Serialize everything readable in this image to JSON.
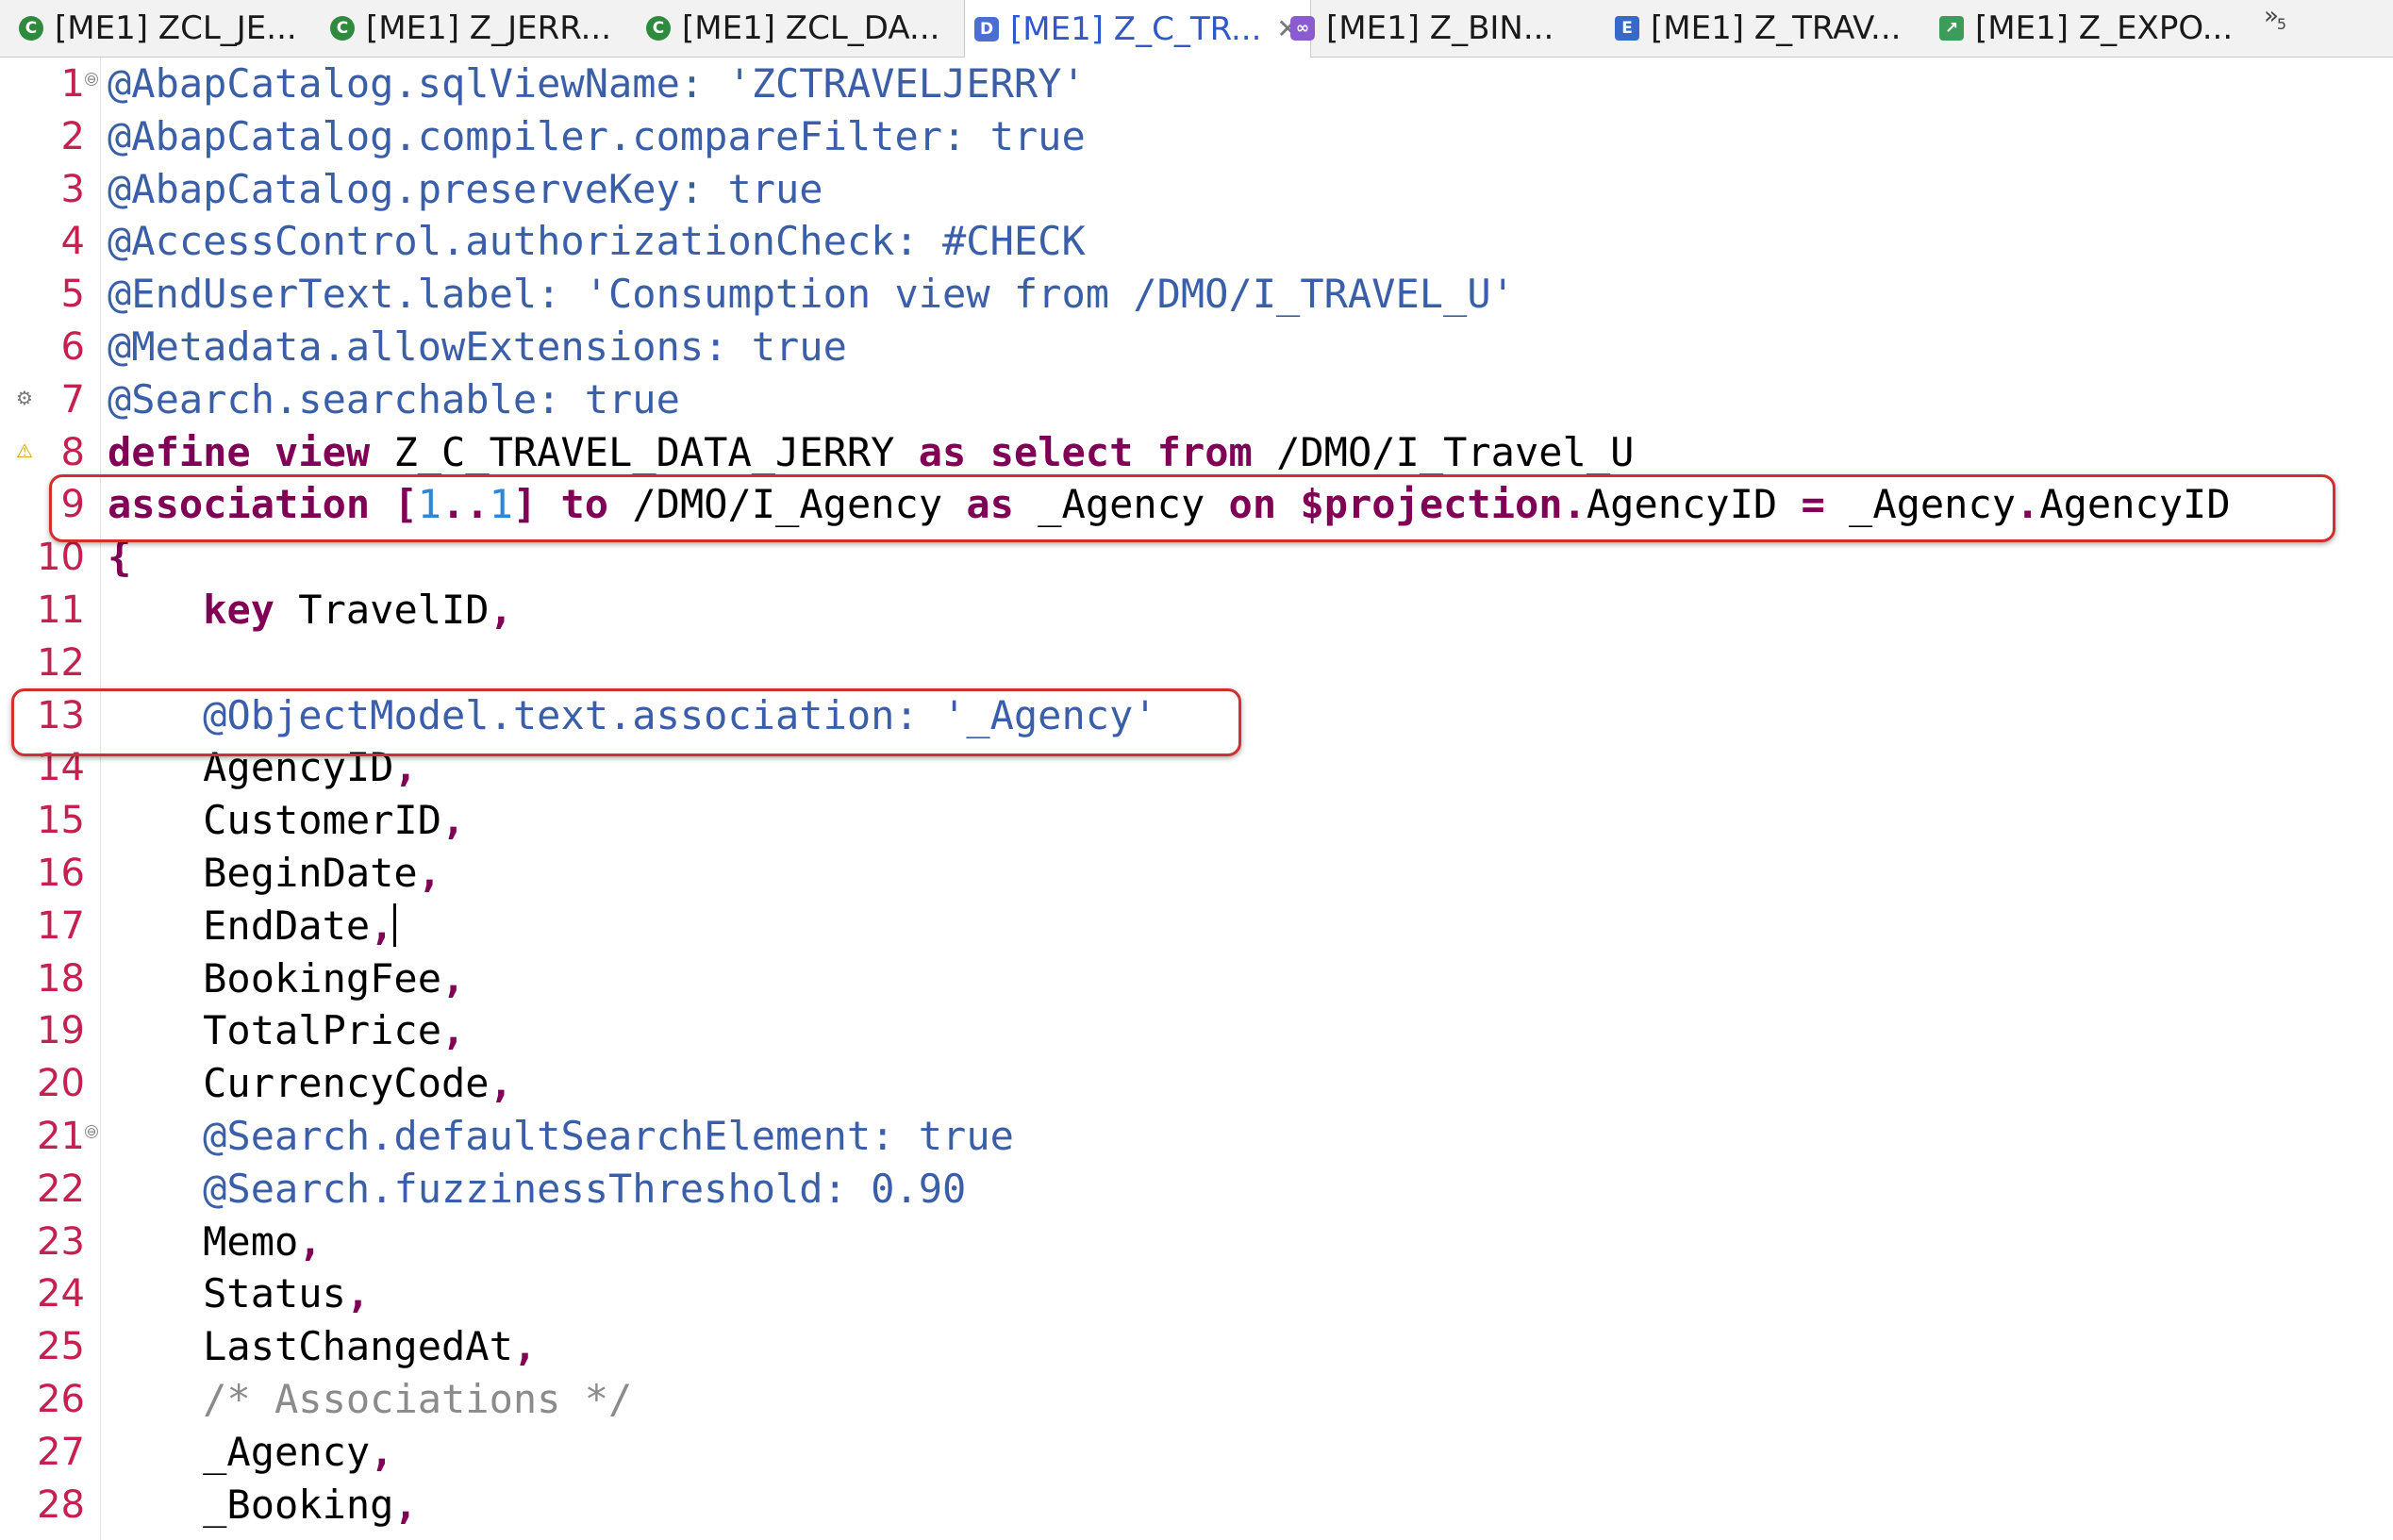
{
  "tabs": [
    {
      "label": "[ME1] ZCL_JE...",
      "icon": "class-icon"
    },
    {
      "label": "[ME1] Z_JERR...",
      "icon": "class-icon"
    },
    {
      "label": "[ME1] ZCL_DA...",
      "icon": "class-icon"
    },
    {
      "label": "[ME1] Z_C_TR...",
      "icon": "ddl-source-icon",
      "active": true,
      "close": "✕"
    },
    {
      "label": "[ME1] Z_BIN...",
      "icon": "service-binding-icon"
    },
    {
      "label": "[ME1] Z_TRAV...",
      "icon": "entity-icon"
    },
    {
      "label": "[ME1] Z_EXPO...",
      "icon": "export-icon"
    }
  ],
  "tab_overflow": {
    "symbol": "»",
    "count": "5"
  },
  "editor": {
    "lines": [
      {
        "n": "1",
        "fold": "⊖",
        "segs": [
          [
            "ann",
            "@AbapCatalog.sqlViewName: "
          ],
          [
            "str2",
            "'ZCTRAVELJERRY'"
          ]
        ]
      },
      {
        "n": "2",
        "segs": [
          [
            "ann",
            "@AbapCatalog.compiler.compareFilter: "
          ],
          [
            "val",
            "true"
          ]
        ]
      },
      {
        "n": "3",
        "segs": [
          [
            "ann",
            "@AbapCatalog.preserveKey: "
          ],
          [
            "val",
            "true"
          ]
        ]
      },
      {
        "n": "4",
        "segs": [
          [
            "ann",
            "@AccessControl.authorizationCheck: "
          ],
          [
            "val",
            "#CHECK"
          ]
        ]
      },
      {
        "n": "5",
        "segs": [
          [
            "ann",
            "@EndUserText.label: "
          ],
          [
            "str2",
            "'Consumption view from /DMO/I_TRAVEL_U'"
          ]
        ]
      },
      {
        "n": "6",
        "segs": [
          [
            "ann",
            "@Metadata.allowExtensions: "
          ],
          [
            "val",
            "true"
          ]
        ]
      },
      {
        "n": "7",
        "marker": "gear",
        "segs": [
          [
            "ann",
            "@Search.searchable: "
          ],
          [
            "val",
            "true"
          ]
        ]
      },
      {
        "n": "8",
        "marker": "warn",
        "segs": [
          [
            "kw",
            "define"
          ],
          [
            "",
            " "
          ],
          [
            "kw",
            "view"
          ],
          [
            "",
            " Z_C_TRAVEL_DATA_JERRY "
          ],
          [
            "kw",
            "as"
          ],
          [
            "",
            " "
          ],
          [
            "kw",
            "select"
          ],
          [
            "",
            " "
          ],
          [
            "kw",
            "from"
          ],
          [
            "",
            " /DMO/I_Travel_U"
          ]
        ]
      },
      {
        "n": "9",
        "segs": [
          [
            "kw",
            "association"
          ],
          [
            "",
            " "
          ],
          [
            "punc",
            "["
          ],
          [
            "num",
            "1"
          ],
          [
            "punc",
            ".."
          ],
          [
            "num",
            "1"
          ],
          [
            "punc",
            "]"
          ],
          [
            "",
            " "
          ],
          [
            "kw",
            "to"
          ],
          [
            "",
            " /DMO/I_Agency "
          ],
          [
            "kw",
            "as"
          ],
          [
            "",
            " _Agency "
          ],
          [
            "kw",
            "on"
          ],
          [
            "",
            " "
          ],
          [
            "kw",
            "$projection"
          ],
          [
            "punc",
            "."
          ],
          [
            "",
            "AgencyID "
          ],
          [
            "punc",
            "="
          ],
          [
            "",
            " _Agency"
          ],
          [
            "punc",
            "."
          ],
          [
            "",
            "AgencyID"
          ]
        ]
      },
      {
        "n": "10",
        "segs": [
          [
            "punc",
            "{"
          ]
        ]
      },
      {
        "n": "11",
        "segs": [
          [
            "",
            "    "
          ],
          [
            "kw",
            "key"
          ],
          [
            "",
            " TravelID"
          ],
          [
            "punc",
            ","
          ]
        ]
      },
      {
        "n": "12",
        "segs": []
      },
      {
        "n": "13",
        "segs": [
          [
            "",
            "    "
          ],
          [
            "ann",
            "@ObjectModel.text.association: "
          ],
          [
            "str2",
            "'_Agency'"
          ]
        ]
      },
      {
        "n": "14",
        "segs": [
          [
            "",
            "    AgencyID"
          ],
          [
            "punc",
            ","
          ]
        ]
      },
      {
        "n": "15",
        "segs": [
          [
            "",
            "    CustomerID"
          ],
          [
            "punc",
            ","
          ]
        ]
      },
      {
        "n": "16",
        "segs": [
          [
            "",
            "    BeginDate"
          ],
          [
            "punc",
            ","
          ]
        ]
      },
      {
        "n": "17",
        "caret": true,
        "segs": [
          [
            "",
            "    EndDate"
          ],
          [
            "punc",
            ","
          ]
        ]
      },
      {
        "n": "18",
        "segs": [
          [
            "",
            "    BookingFee"
          ],
          [
            "punc",
            ","
          ]
        ]
      },
      {
        "n": "19",
        "segs": [
          [
            "",
            "    TotalPrice"
          ],
          [
            "punc",
            ","
          ]
        ]
      },
      {
        "n": "20",
        "segs": [
          [
            "",
            "    CurrencyCode"
          ],
          [
            "punc",
            ","
          ]
        ]
      },
      {
        "n": "21",
        "fold": "⊖",
        "segs": [
          [
            "",
            "    "
          ],
          [
            "ann",
            "@Search.defaultSearchElement: "
          ],
          [
            "val",
            "true"
          ]
        ]
      },
      {
        "n": "22",
        "segs": [
          [
            "",
            "    "
          ],
          [
            "ann",
            "@Search.fuzzinessThreshold: "
          ],
          [
            "val",
            "0.90"
          ]
        ]
      },
      {
        "n": "23",
        "segs": [
          [
            "",
            "    Memo"
          ],
          [
            "punc",
            ","
          ]
        ]
      },
      {
        "n": "24",
        "segs": [
          [
            "",
            "    Status"
          ],
          [
            "punc",
            ","
          ]
        ]
      },
      {
        "n": "25",
        "segs": [
          [
            "",
            "    LastChangedAt"
          ],
          [
            "punc",
            ","
          ]
        ]
      },
      {
        "n": "26",
        "segs": [
          [
            "",
            "    "
          ],
          [
            "cmt",
            "/* Associations */"
          ]
        ]
      },
      {
        "n": "27",
        "segs": [
          [
            "",
            "    _Agency"
          ],
          [
            "punc",
            ","
          ]
        ]
      },
      {
        "n": "28",
        "segs": [
          [
            "",
            "    _Booking"
          ],
          [
            "punc",
            ","
          ]
        ]
      }
    ]
  },
  "colors": {
    "keyword": "#7f0055",
    "annotation": "#3a5fa8",
    "line_number": "#c42150",
    "highlight_box": "#d32d2d",
    "active_tab_text": "#2f58c9"
  }
}
